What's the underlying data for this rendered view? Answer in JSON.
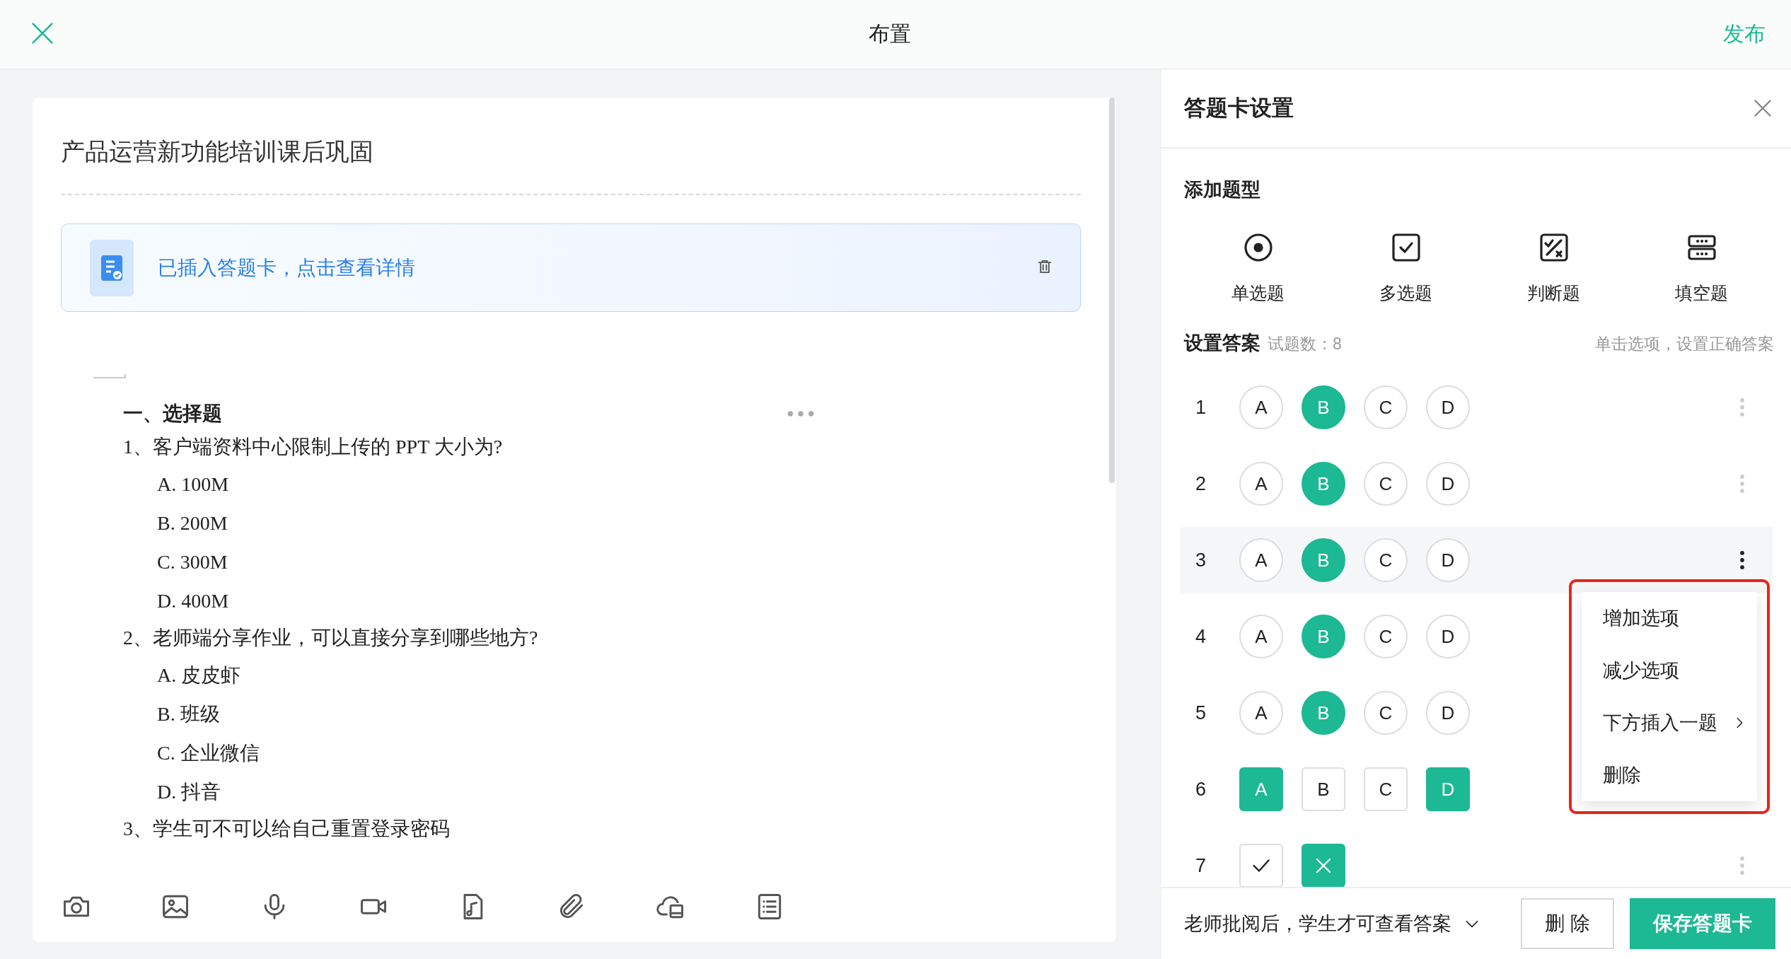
{
  "top_bar": {
    "title": "布置",
    "publish": "发布"
  },
  "editor": {
    "title": "产品运营新功能培训课后巩固",
    "banner": {
      "text": "已插入答题卡，点击查看详情"
    },
    "lines": [
      {
        "kind": "heading",
        "text": "一、选择题"
      },
      {
        "kind": "question",
        "text": "1、客户端资料中心限制上传的 PPT 大小为?"
      },
      {
        "kind": "option",
        "text": "A. 100M"
      },
      {
        "kind": "option",
        "text": "B. 200M"
      },
      {
        "kind": "option",
        "text": "C. 300M"
      },
      {
        "kind": "option",
        "text": "D. 400M"
      },
      {
        "kind": "question",
        "text": "2、老师端分享作业，可以直接分享到哪些地方?"
      },
      {
        "kind": "option",
        "text": "A.  皮皮虾"
      },
      {
        "kind": "option",
        "text": "B.  班级"
      },
      {
        "kind": "option",
        "text": "C.  企业微信"
      },
      {
        "kind": "option",
        "text": "D.  抖音"
      },
      {
        "kind": "question",
        "text": "3、学生可不可以给自己重置登录密码"
      }
    ]
  },
  "panel": {
    "title": "答题卡设置",
    "add_section": "添加题型",
    "question_types": [
      {
        "kind": "single",
        "label": "单选题"
      },
      {
        "kind": "multi",
        "label": "多选题"
      },
      {
        "kind": "judge",
        "label": "判断题"
      },
      {
        "kind": "blank",
        "label": "填空题"
      }
    ],
    "answers_title": "设置答案",
    "count": "试题数：8",
    "hint": "单击选项，设置正确答案",
    "rows": [
      {
        "number": "1",
        "kind": "single",
        "active": false,
        "options": [
          {
            "label": "A",
            "selected": false
          },
          {
            "label": "B",
            "selected": true
          },
          {
            "label": "C",
            "selected": false
          },
          {
            "label": "D",
            "selected": false
          }
        ]
      },
      {
        "number": "2",
        "kind": "single",
        "active": false,
        "options": [
          {
            "label": "A",
            "selected": false
          },
          {
            "label": "B",
            "selected": true
          },
          {
            "label": "C",
            "selected": false
          },
          {
            "label": "D",
            "selected": false
          }
        ]
      },
      {
        "number": "3",
        "kind": "single",
        "active": true,
        "options": [
          {
            "label": "A",
            "selected": false
          },
          {
            "label": "B",
            "selected": true
          },
          {
            "label": "C",
            "selected": false
          },
          {
            "label": "D",
            "selected": false
          }
        ]
      },
      {
        "number": "4",
        "kind": "single",
        "active": false,
        "options": [
          {
            "label": "A",
            "selected": false
          },
          {
            "label": "B",
            "selected": true
          },
          {
            "label": "C",
            "selected": false
          },
          {
            "label": "D",
            "selected": false
          }
        ]
      },
      {
        "number": "5",
        "kind": "single",
        "active": false,
        "options": [
          {
            "label": "A",
            "selected": false
          },
          {
            "label": "B",
            "selected": true
          },
          {
            "label": "C",
            "selected": false
          },
          {
            "label": "D",
            "selected": false
          }
        ]
      },
      {
        "number": "6",
        "kind": "multi",
        "active": false,
        "options": [
          {
            "label": "A",
            "selected": true
          },
          {
            "label": "B",
            "selected": false
          },
          {
            "label": "C",
            "selected": false
          },
          {
            "label": "D",
            "selected": true
          }
        ]
      },
      {
        "number": "7",
        "kind": "judge",
        "active": false,
        "options": [
          {
            "kind": "check",
            "selected": false
          },
          {
            "kind": "cross",
            "selected": true
          }
        ]
      }
    ],
    "menu": {
      "highlighted": true,
      "items": [
        {
          "kind": "item",
          "label": "增加选项"
        },
        {
          "kind": "item",
          "label": "减少选项"
        },
        {
          "kind": "submenu",
          "label": "下方插入一题"
        },
        {
          "kind": "item",
          "label": "删除"
        }
      ]
    },
    "footer": {
      "visibility": "老师批阅后，学生才可查看答案",
      "buttons": [
        {
          "kind": "secondary",
          "label": "删 除"
        },
        {
          "kind": "primary",
          "label": "保存答题卡"
        }
      ]
    }
  }
}
